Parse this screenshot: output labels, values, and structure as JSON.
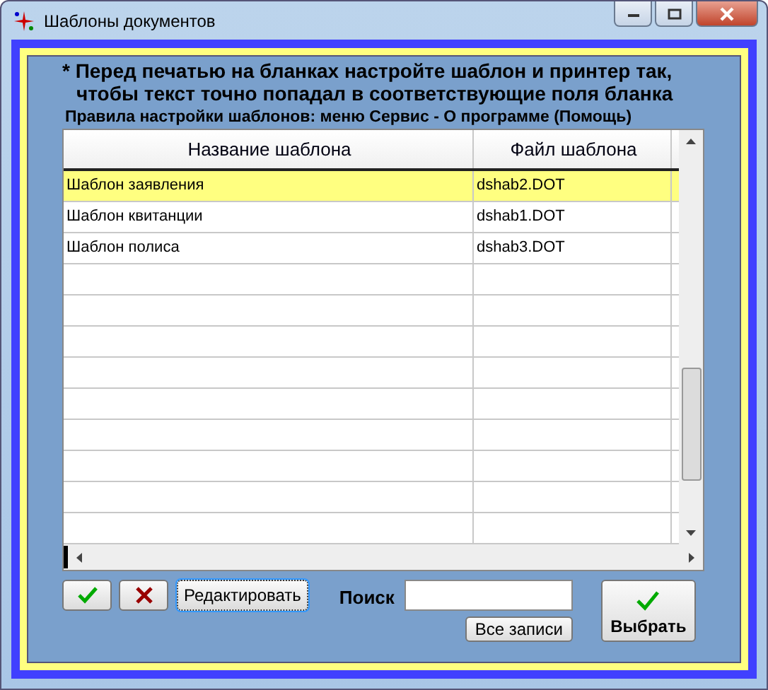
{
  "window": {
    "title": "Шаблоны документов"
  },
  "notice": {
    "lines": [
      "* Перед печатью на бланках настройте шаблон и принтер так,",
      "чтобы текст точно попадал в соответствующие поля бланка"
    ],
    "hint": "Правила настройки шаблонов:  меню Сервис - О программе (Помощь)"
  },
  "table": {
    "columns": [
      "Название шаблона",
      "Файл шаблона"
    ],
    "rows": [
      {
        "cells": [
          "Шаблон заявления",
          "dshab2.DOT"
        ],
        "selected": true
      },
      {
        "cells": [
          "Шаблон квитанции",
          "dshab1.DOT"
        ],
        "selected": false
      },
      {
        "cells": [
          "Шаблон полиса",
          "dshab3.DOT"
        ],
        "selected": false
      }
    ]
  },
  "buttons": {
    "edit": "Редактировать",
    "all_records": "Все записи",
    "choose": "Выбрать"
  },
  "search": {
    "label": "Поиск"
  }
}
